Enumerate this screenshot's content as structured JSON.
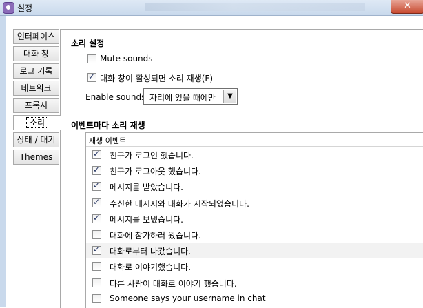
{
  "window": {
    "title": "설정",
    "close_glyph": "✕"
  },
  "tabs": [
    {
      "label": "인터페이스",
      "active": false
    },
    {
      "label": "대화 창",
      "active": false
    },
    {
      "label": "로그 기록",
      "active": false
    },
    {
      "label": "네트워크",
      "active": false
    },
    {
      "label": "프록시",
      "active": false
    },
    {
      "label": "소리",
      "active": true
    },
    {
      "label": "상태 / 대기",
      "active": false
    },
    {
      "label": "Themes",
      "active": false
    }
  ],
  "sound_settings": {
    "heading": "소리 설정",
    "mute_label": "Mute sounds",
    "mute_checked": false,
    "focus_label": "대화 창이 활성되면 소리 재생(F)",
    "focus_checked": true,
    "enable_label": "Enable sounds:",
    "enable_value": "자리에 있을 때에만",
    "dropdown_glyph": "▼"
  },
  "events": {
    "heading": "이벤트마다 소리 재생",
    "column_header": "재생  이벤트",
    "rows": [
      {
        "label": "친구가 로그인 했습니다.",
        "checked": true,
        "selected": false
      },
      {
        "label": "친구가 로그아웃 했습니다.",
        "checked": true,
        "selected": false
      },
      {
        "label": "메시지를 받았습니다.",
        "checked": true,
        "selected": false
      },
      {
        "label": "수신한 메시지와 대화가 시작되었습니다.",
        "checked": true,
        "selected": false
      },
      {
        "label": "메시지를 보냈습니다.",
        "checked": true,
        "selected": false
      },
      {
        "label": "대화에 참가하러 왔습니다.",
        "checked": false,
        "selected": false
      },
      {
        "label": "대화로부터 나갔습니다.",
        "checked": true,
        "selected": true
      },
      {
        "label": "대화로 이야기했습니다.",
        "checked": false,
        "selected": false
      },
      {
        "label": "다른 사람이 대화로 이야기 했습니다.",
        "checked": false,
        "selected": false
      },
      {
        "label": "Someone says your username in chat",
        "checked": false,
        "selected": false
      }
    ]
  }
}
